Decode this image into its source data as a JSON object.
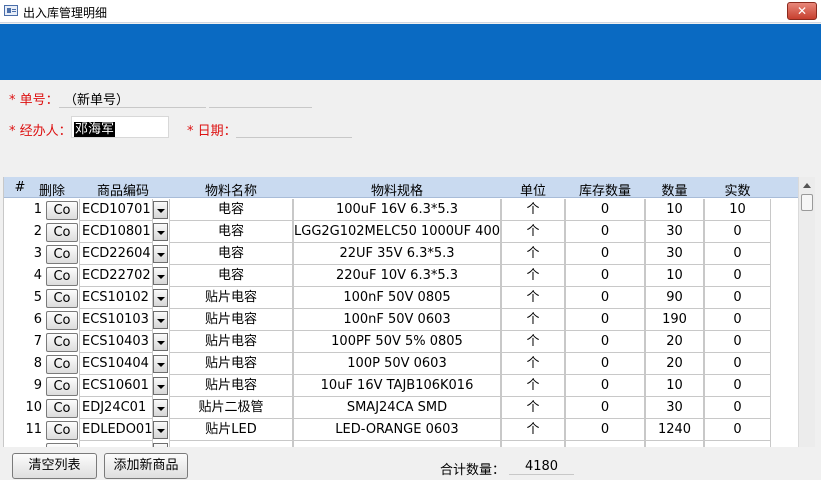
{
  "window": {
    "title": "出入库管理明细",
    "close_label": "✕"
  },
  "form": {
    "order_no": {
      "label": "* 单号：",
      "value": "（新单号）"
    },
    "handler": {
      "label": "* 经办人：",
      "value": "邓海军"
    },
    "date": {
      "label": "* 日期：",
      "value": ""
    }
  },
  "grid": {
    "headers": [
      "#",
      "删除",
      "商品编码",
      "物料名称",
      "物料规格",
      "单位",
      "库存数量",
      "数量",
      "实数"
    ],
    "delete_label": "Co",
    "rows": [
      {
        "no": "1",
        "code": "ECD10701",
        "name": "电容",
        "spec": "100uF 16V 6.3*5.3",
        "unit": "个",
        "stock": "0",
        "qty": "10",
        "real": "10"
      },
      {
        "no": "2",
        "code": "ECD10801",
        "name": "电容",
        "spec": "LGG2G102MELC50 1000UF 400V",
        "unit": "个",
        "stock": "0",
        "qty": "30",
        "real": "0"
      },
      {
        "no": "3",
        "code": "ECD22604",
        "name": "电容",
        "spec": "22UF 35V 6.3*5.3",
        "unit": "个",
        "stock": "0",
        "qty": "30",
        "real": "0"
      },
      {
        "no": "4",
        "code": "ECD22702",
        "name": "电容",
        "spec": "220uF 10V 6.3*5.3",
        "unit": "个",
        "stock": "0",
        "qty": "10",
        "real": "0"
      },
      {
        "no": "5",
        "code": "ECS10102",
        "name": "贴片电容",
        "spec": "100nF 50V 0805",
        "unit": "个",
        "stock": "0",
        "qty": "90",
        "real": "0"
      },
      {
        "no": "6",
        "code": "ECS10103",
        "name": "贴片电容",
        "spec": "100nF 50V 0603",
        "unit": "个",
        "stock": "0",
        "qty": "190",
        "real": "0"
      },
      {
        "no": "7",
        "code": "ECS10403",
        "name": "贴片电容",
        "spec": "100PF 50V 5% 0805",
        "unit": "个",
        "stock": "0",
        "qty": "20",
        "real": "0"
      },
      {
        "no": "8",
        "code": "ECS10404",
        "name": "贴片电容",
        "spec": "100P 50V  0603",
        "unit": "个",
        "stock": "0",
        "qty": "20",
        "real": "0"
      },
      {
        "no": "9",
        "code": "ECS10601",
        "name": "贴片电容",
        "spec": "10uF 16V TAJB106K016",
        "unit": "个",
        "stock": "0",
        "qty": "10",
        "real": "0"
      },
      {
        "no": "10",
        "code": "EDJ24C01",
        "name": "贴片二极管",
        "spec": "SMAJ24CA SMD",
        "unit": "个",
        "stock": "0",
        "qty": "30",
        "real": "0"
      },
      {
        "no": "11",
        "code": "EDLEDO01",
        "name": "贴片LED",
        "spec": "LED-ORANGE 0603",
        "unit": "个",
        "stock": "0",
        "qty": "1240",
        "real": "0"
      }
    ]
  },
  "footer": {
    "clear_button": "清空列表",
    "add_button": "添加新商品",
    "total_label": "合计数量：",
    "total_value": "4180"
  },
  "colors": {
    "banner": "#0a6ac2",
    "header_row": "#c9daf0",
    "required": "#dd1111"
  }
}
